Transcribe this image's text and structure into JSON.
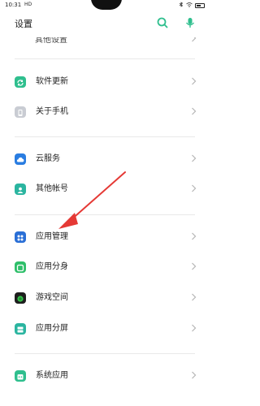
{
  "status_bar": {
    "time": "10:31",
    "network": "HD"
  },
  "header": {
    "title": "设置"
  },
  "partial_item": {
    "label": "其他设置"
  },
  "items": [
    {
      "label": "软件更新",
      "icon": "update-icon",
      "color": "#2fbf8e"
    },
    {
      "label": "关于手机",
      "icon": "phone-info-icon",
      "color": "#bfc3cc"
    },
    {
      "label": "云服务",
      "icon": "cloud-icon",
      "color": "#2a7de1"
    },
    {
      "label": "其他帐号",
      "icon": "account-icon",
      "color": "#2bb5a0"
    },
    {
      "label": "应用管理",
      "icon": "app-grid-icon",
      "color": "#2a6fd6"
    },
    {
      "label": "应用分身",
      "icon": "app-clone-icon",
      "color": "#2fbf6a"
    },
    {
      "label": "游戏空间",
      "icon": "game-space-icon",
      "color": "#1e1e1e"
    },
    {
      "label": "应用分屏",
      "icon": "split-screen-icon",
      "color": "#2bb5a0"
    },
    {
      "label": "系统应用",
      "icon": "system-apps-icon",
      "color": "#2fbf8e"
    }
  ],
  "colors": {
    "accent": "#2fbf8e",
    "annotation_arrow": "#e53935"
  }
}
